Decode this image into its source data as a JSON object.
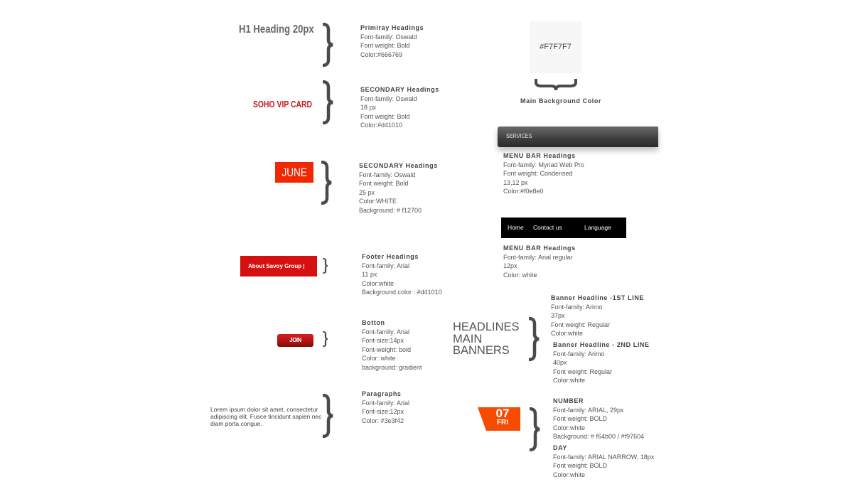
{
  "samples": {
    "h1": "H1 Heading  20px",
    "soho": "SOHO VIP CARD",
    "june": "JUNE",
    "footer": "About Savoy Group  |",
    "join": "JOIN",
    "paragraph": "Lorem ipsum dolor sit amet, consectetur adipiscing elit. Fusce tincidunt sapien nec diam porta congue.",
    "bg_swatch": "#F7F7F7",
    "bg_label": "Main Background Color",
    "services": "SERVICES",
    "nav": [
      "Home",
      "Contact us",
      "Language"
    ],
    "headlines": [
      "HEADLINES",
      "MAIN",
      "BANNERS"
    ],
    "date_number": "07",
    "date_day": "FRI"
  },
  "colors": {
    "h1": "#666769",
    "secondary": "#d41010",
    "june_bg": "#f12700",
    "footer_bg": "#d41010",
    "page_bg": "#F7F7F7",
    "date_bg": "#f64b00"
  },
  "specs": [
    {
      "id": "primary",
      "title": "Primiray Headings",
      "lines": [
        "Font-family: Oswald",
        "Font weight: Bold",
        "Color:#666769"
      ]
    },
    {
      "id": "secondary",
      "title": "SECONDARY Headings",
      "lines": [
        "Font-family: Oswald",
        "18 px",
        "Font weight: Bold",
        "Color:#d41010"
      ]
    },
    {
      "id": "secondary-june",
      "title": "SECONDARY Headings",
      "lines": [
        "Font-family: Oswald",
        "Font weight: Bold",
        "25 px",
        "Color:WHITE",
        "Background: # f12700"
      ]
    },
    {
      "id": "footer",
      "title": "Footer Headings",
      "lines": [
        "Font-family: Arial",
        "11 px",
        "Color:white",
        "Background color : #d41010"
      ]
    },
    {
      "id": "button",
      "title": "Botton",
      "lines": [
        "Font-family: Arial",
        "Font-size:14px",
        "Font-weight: bold",
        "Color: white",
        "background: gradient"
      ]
    },
    {
      "id": "paragraphs",
      "title": "Paragraphs",
      "lines": [
        "Font-family: Arial",
        "Font-size:12px",
        "Color: #3e3f42"
      ]
    },
    {
      "id": "menubar-services",
      "title": "MENU BAR Headings",
      "lines": [
        "Font-family: Myriad Web Pro",
        "Font weight: Condensed",
        "13,12 px",
        "Color:#f0e8e0"
      ]
    },
    {
      "id": "menubar-nav",
      "title": "MENU BAR Headings",
      "lines": [
        "Font-family: Arial regular",
        "12px",
        "Color: white"
      ]
    },
    {
      "id": "banner-1",
      "title": "Banner Headline -1ST LINE",
      "lines": [
        "Font-family: Arimo",
        "37px",
        "Font weight: Regular",
        "Color:white"
      ]
    },
    {
      "id": "banner-2",
      "title": "Banner Headline - 2ND LINE",
      "lines": [
        "Font-family: Arimo",
        "40px",
        "Font weight: Regular",
        "Color:white"
      ]
    },
    {
      "id": "number",
      "title": "NUMBER",
      "lines": [
        "Font-family: ARIAL, 29px",
        "Font weight: BOLD",
        "Color:white",
        "Background: # f64b00 / #f97604"
      ]
    },
    {
      "id": "day",
      "title": "DAY",
      "lines": [
        "Font-family: ARIAL NARROW, 18px",
        "Font weight: BOLD",
        "Color:white"
      ]
    }
  ]
}
